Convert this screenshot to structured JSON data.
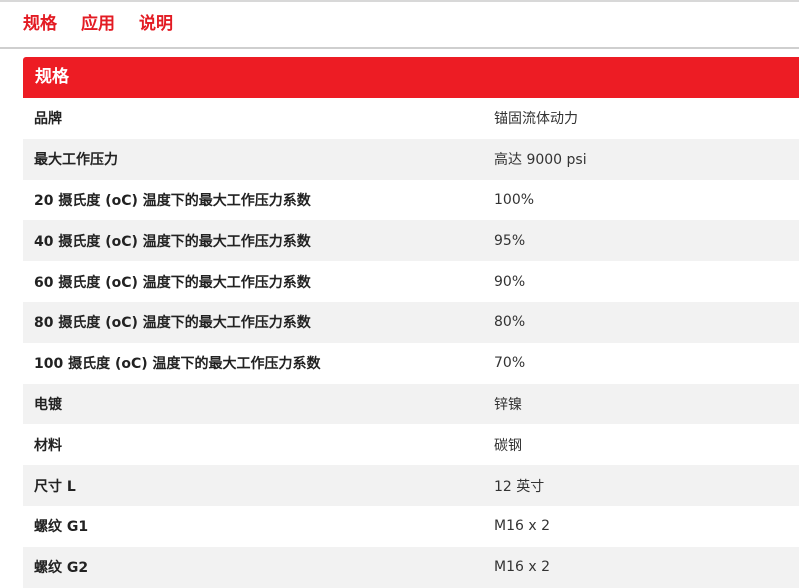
{
  "tabs": [
    {
      "label": "规格"
    },
    {
      "label": "应用"
    },
    {
      "label": "说明"
    }
  ],
  "spec": {
    "header": "规格",
    "rows": [
      {
        "label": "品牌",
        "value": "锚固流体动力"
      },
      {
        "label": "最大工作压力",
        "value": "高达 9000 psi"
      },
      {
        "label": "20 摄氏度 (oC) 温度下的最大工作压力系数",
        "value": "100%"
      },
      {
        "label": "40 摄氏度 (oC) 温度下的最大工作压力系数",
        "value": "95%"
      },
      {
        "label": "60 摄氏度 (oC) 温度下的最大工作压力系数",
        "value": "90%"
      },
      {
        "label": "80 摄氏度 (oC) 温度下的最大工作压力系数",
        "value": "80%"
      },
      {
        "label": "100 摄氏度 (oC) 温度下的最大工作压力系数",
        "value": "70%"
      },
      {
        "label": "电镀",
        "value": "锌镍"
      },
      {
        "label": "材料",
        "value": "碳钢"
      },
      {
        "label": "尺寸 L",
        "value": "12 英寸"
      },
      {
        "label": "螺纹 G1",
        "value": "M16 x 2"
      },
      {
        "label": "螺纹 G2",
        "value": "M16 x 2"
      }
    ]
  },
  "colors": {
    "accent": "#ed1c24",
    "tab_text": "#e31b23",
    "row_alt": "#f2f2f2"
  }
}
